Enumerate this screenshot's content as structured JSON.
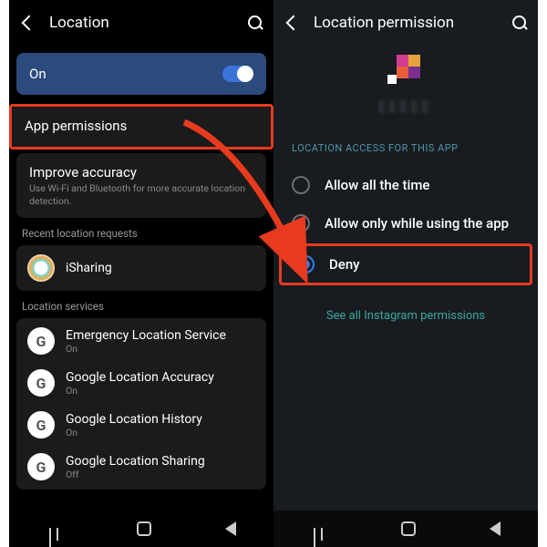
{
  "left_screen": {
    "header_title": "Location",
    "toggle_label": "On",
    "app_permissions_label": "App permissions",
    "improve_accuracy": {
      "title": "Improve accuracy",
      "subtitle": "Use Wi-Fi and Bluetooth for more accurate location detection."
    },
    "recent_requests_label": "Recent location requests",
    "recent_items": [
      {
        "name": "iSharing"
      }
    ],
    "location_services_label": "Location services",
    "services": [
      {
        "name": "Emergency Location Service",
        "state": "On"
      },
      {
        "name": "Google Location Accuracy",
        "state": "On"
      },
      {
        "name": "Google Location History",
        "state": "On"
      },
      {
        "name": "Google Location Sharing",
        "state": "Off"
      }
    ]
  },
  "right_screen": {
    "header_title": "Location permission",
    "section_header": "LOCATION ACCESS FOR THIS APP",
    "options": [
      {
        "label": "Allow all the time",
        "selected": false
      },
      {
        "label": "Allow only while using the app",
        "selected": false
      },
      {
        "label": "Deny",
        "selected": true
      }
    ],
    "see_all_link": "See all Instagram permissions"
  },
  "annotation": {
    "highlight_color": "#e83a1f",
    "arrow_from": "App permissions row (left screen)",
    "arrow_to": "Deny option (right screen)"
  }
}
